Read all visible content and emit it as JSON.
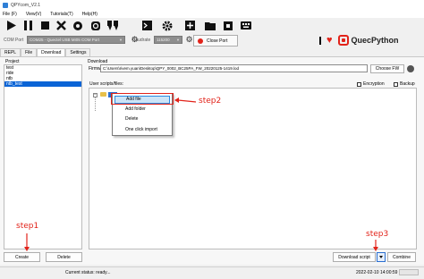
{
  "window": {
    "title": "QPYcom_V2.1"
  },
  "menu": {
    "items": [
      "File (F)",
      "View(V)",
      "Tutorials(T)",
      "Help(H)"
    ]
  },
  "toolbar": {
    "icons": [
      "run-icon",
      "pause-icon",
      "stop-icon",
      "clear-icon",
      "settings-icon",
      "download-icon",
      "quote-icon",
      "terminal-icon",
      "settings-gear-icon",
      "add-icon",
      "folder-icon",
      "expand-icon",
      "keyboard-icon"
    ]
  },
  "connection": {
    "com_label": "COM Port",
    "com_value": "COM25 - Quectel USB MI05 COM Port",
    "baud_label": "Baudrate",
    "baud_value": "115200",
    "close_port_label": "Close Port"
  },
  "brand": {
    "name": "QuecPython",
    "color": "#e2231a"
  },
  "tabs": [
    "REPL",
    "File",
    "Download",
    "Settings"
  ],
  "active_tab": "Download",
  "project": {
    "label": "Project",
    "items": [
      "test",
      "ride",
      "ntb",
      "ntb_test"
    ],
    "selected": "ntb_test",
    "create_label": "Create",
    "delete_label": "Delete"
  },
  "download": {
    "section_label": "Download",
    "firmware_label": "Firmware:",
    "firmware_path": "C:\\Users\\rivem.yuan\\Desktop\\QPY_0002_BC25PA_FW_20220125-1419.lod",
    "choose_fw_label": "Choose FW",
    "scripts_label": "User scripts/files:",
    "encryption_label": "Encryption",
    "backup_label": "Backup",
    "download_script_label": "Download script",
    "combine_label": "Combine"
  },
  "context_menu": {
    "items": [
      "Add file",
      "Add folder",
      "Delete",
      "One click import"
    ],
    "highlighted": "Add file"
  },
  "annotations": {
    "step1": "step1",
    "step2": "step2",
    "step3": "step3",
    "color": "#e2231a"
  },
  "status": {
    "text": "Current status: ready...",
    "time": "2022-02-10 14:00:59",
    "progress": 0
  }
}
